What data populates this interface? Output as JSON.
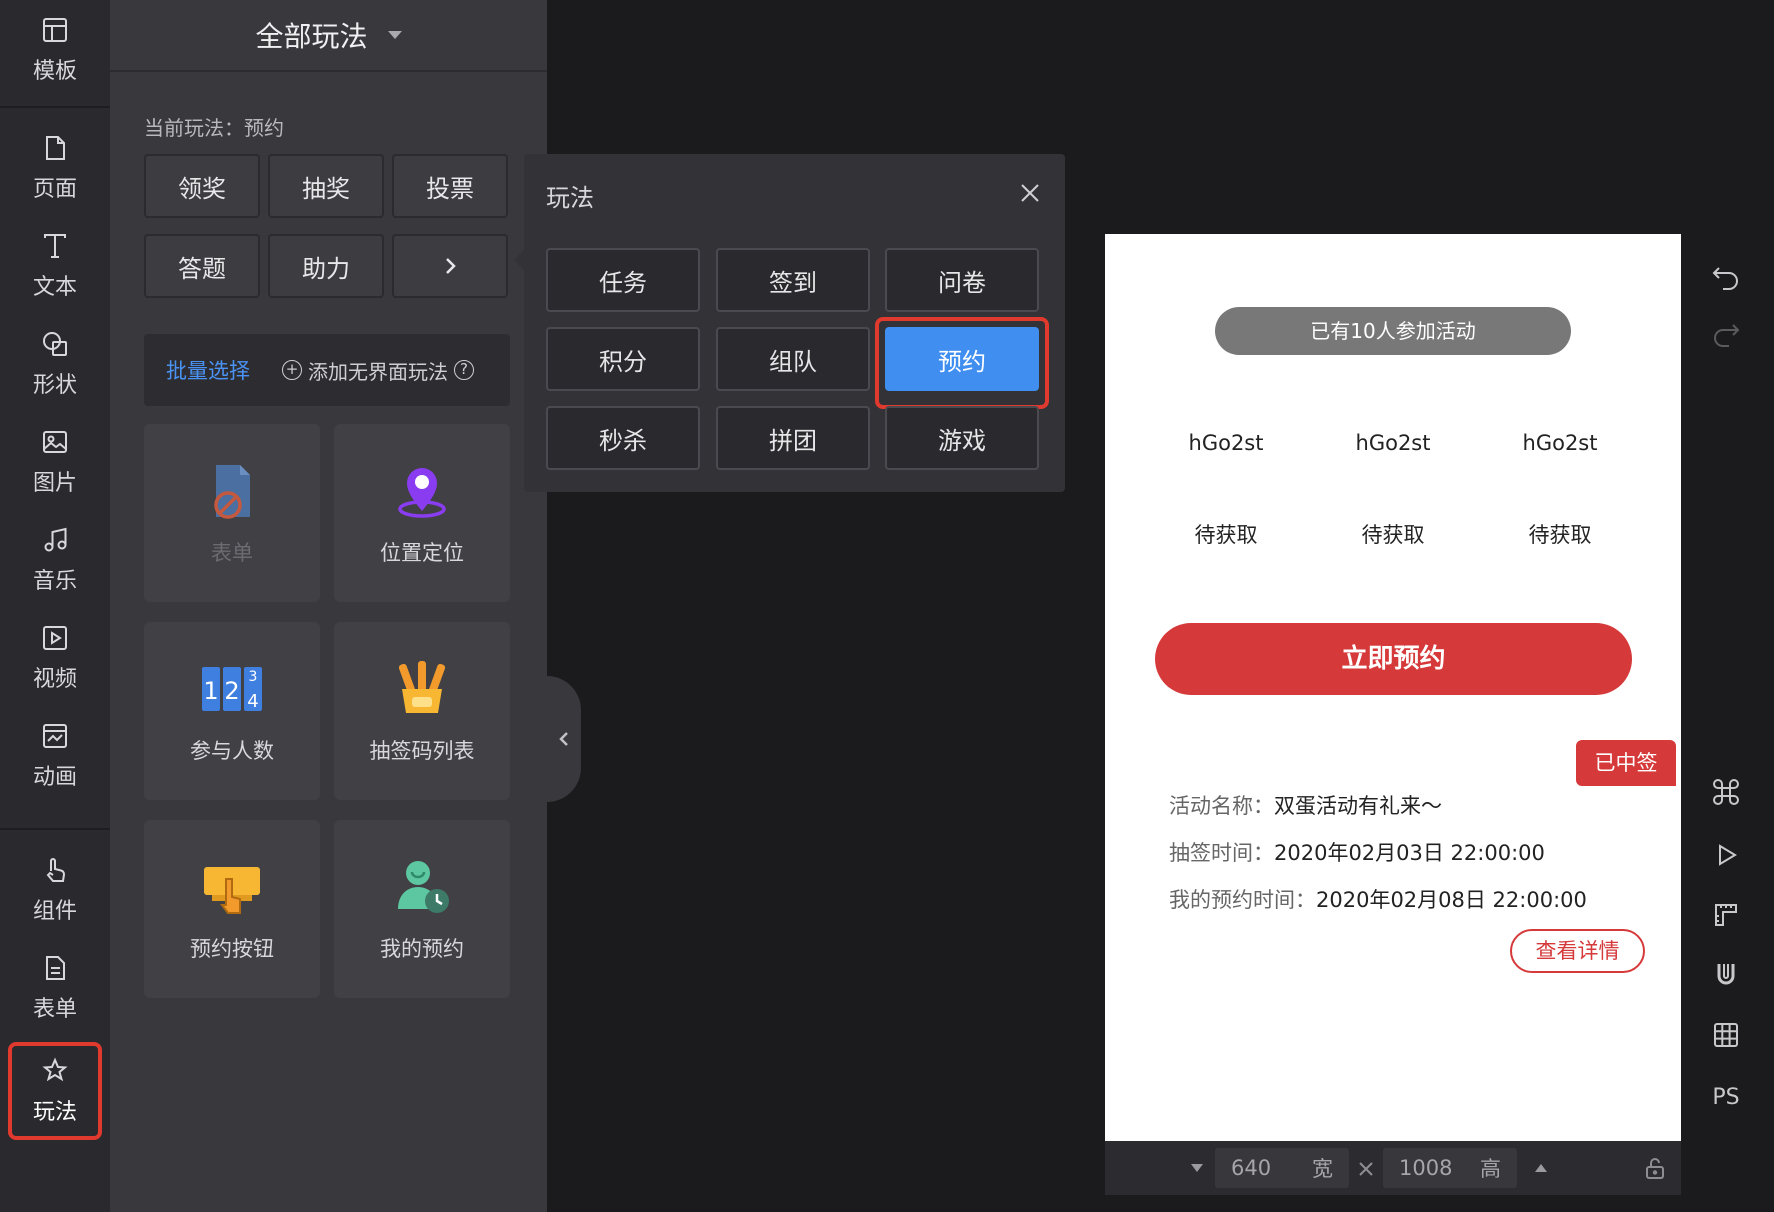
{
  "rail": {
    "items": [
      {
        "label": "模板",
        "icon": "template-icon"
      },
      {
        "label": "页面",
        "icon": "page-icon"
      },
      {
        "label": "文本",
        "icon": "text-icon"
      },
      {
        "label": "形状",
        "icon": "shape-icon"
      },
      {
        "label": "图片",
        "icon": "image-icon"
      },
      {
        "label": "音乐",
        "icon": "music-icon"
      },
      {
        "label": "视频",
        "icon": "video-icon"
      },
      {
        "label": "动画",
        "icon": "animation-icon"
      },
      {
        "label": "组件",
        "icon": "component-icon"
      },
      {
        "label": "表单",
        "icon": "form-icon"
      },
      {
        "label": "玩法",
        "icon": "gameplay-icon",
        "active": true
      }
    ]
  },
  "panel": {
    "title": "全部玩法",
    "current": "当前玩法：预约",
    "quick": [
      "领奖",
      "抽奖",
      "投票",
      "答题",
      "助力"
    ],
    "batch_select": "批量选择",
    "add_borderless": "添加无界面玩法",
    "help_glyph": "?",
    "cards": [
      {
        "label": "表单",
        "icon": "form-disabled-icon",
        "disabled": true
      },
      {
        "label": "位置定位",
        "icon": "location-pin-icon"
      },
      {
        "label": "参与人数",
        "icon": "counter-digits-icon"
      },
      {
        "label": "抽签码列表",
        "icon": "lottery-codes-icon"
      },
      {
        "label": "预约按钮",
        "icon": "reserve-button-icon"
      },
      {
        "label": "我的预约",
        "icon": "my-reservation-icon"
      }
    ]
  },
  "popover": {
    "title": "玩法",
    "options": [
      "任务",
      "签到",
      "问卷",
      "积分",
      "组队",
      "预约",
      "秒杀",
      "拼团",
      "游戏"
    ],
    "selected": "预约"
  },
  "preview": {
    "participants": "已有10人参加活动",
    "codes": [
      "hGo2st",
      "hGo2st",
      "hGo2st"
    ],
    "status": [
      "待获取",
      "待获取",
      "待获取"
    ],
    "reserve_button": "立即预约",
    "won_badge": "已中签",
    "activity_name_label": "活动名称：",
    "activity_name": "双蛋活动有礼来～",
    "draw_time_label": "抽签时间：",
    "draw_time": "2020年02月03日 22:00:00",
    "my_time_label": "我的预约时间：",
    "my_time": "2020年02月08日 22:00:00",
    "detail_button": "查看详情"
  },
  "size_bar": {
    "width": "640",
    "width_unit": "宽",
    "height": "1008",
    "height_unit": "高"
  },
  "tools": {
    "ps_label": "PS"
  },
  "colors": {
    "accent_red": "#d6393a",
    "highlight_red": "#e0392e",
    "selected_blue": "#3f8ef0",
    "link_blue": "#4a92f3"
  }
}
